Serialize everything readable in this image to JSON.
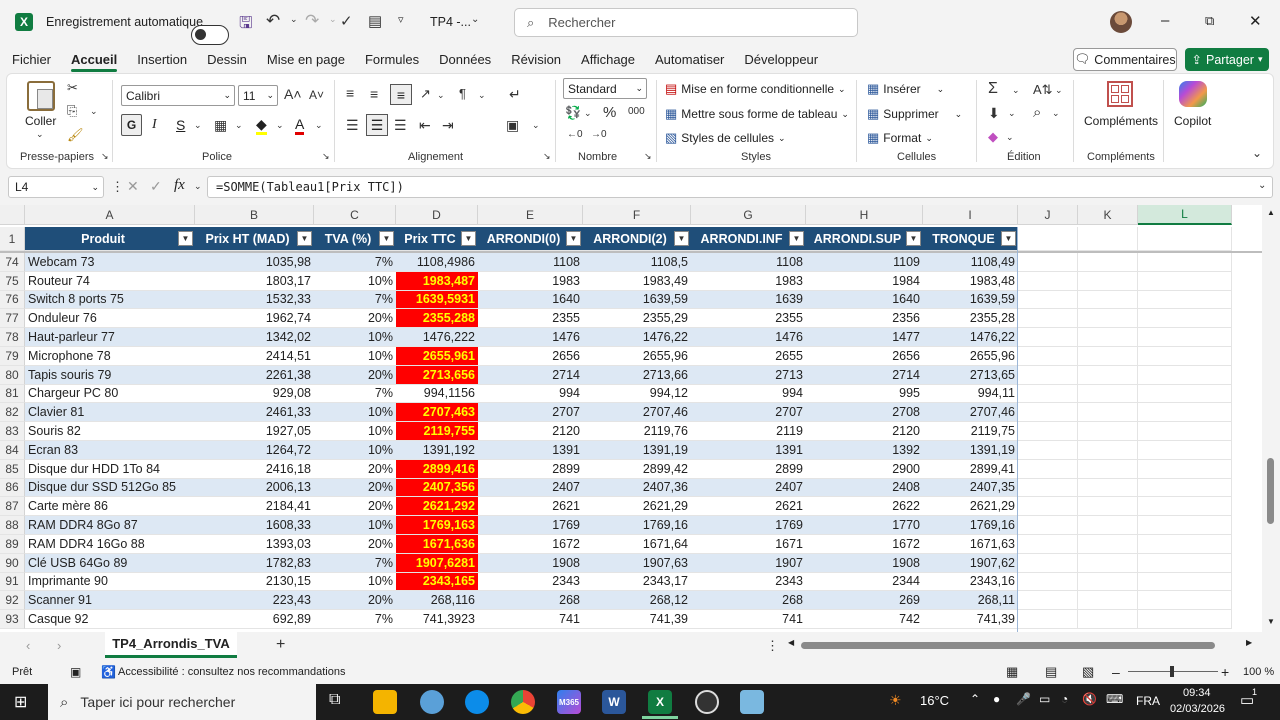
{
  "titlebar": {
    "autosave_label": "Enregistrement automatique",
    "doc_title": "TP4 -...",
    "search_placeholder": "Rechercher"
  },
  "menu": {
    "tabs": [
      "Fichier",
      "Accueil",
      "Insertion",
      "Dessin",
      "Mise en page",
      "Formules",
      "Données",
      "Révision",
      "Affichage",
      "Automatiser",
      "Développeur"
    ],
    "active": "Accueil",
    "comments": "Commentaires",
    "share": "Partager"
  },
  "ribbon": {
    "clipboard": {
      "paste": "Coller",
      "label": "Presse-papiers"
    },
    "font": {
      "name": "Calibri",
      "size": "11",
      "label": "Police"
    },
    "alignment": {
      "label": "Alignement"
    },
    "number": {
      "format": "Standard",
      "label": "Nombre"
    },
    "styles": {
      "cond_format": "Mise en forme conditionnelle",
      "as_table": "Mettre sous forme de tableau",
      "cell_styles": "Styles de cellules",
      "label": "Styles"
    },
    "cells": {
      "insert": "Insérer",
      "delete": "Supprimer",
      "format": "Format",
      "label": "Cellules"
    },
    "editing": {
      "label": "Édition"
    },
    "addins": {
      "btn": "Compléments",
      "label": "Compléments"
    },
    "copilot": "Copilot"
  },
  "formula_bar": {
    "namebox": "L4",
    "formula": "=SOMME(Tableau1[Prix TTC])"
  },
  "grid": {
    "col_letters": [
      "A",
      "B",
      "C",
      "D",
      "E",
      "F",
      "G",
      "H",
      "I",
      "J",
      "K",
      "L"
    ],
    "headers": [
      "Produit",
      "Prix HT (MAD)",
      "TVA (%)",
      "Prix TTC",
      "ARRONDI(0)",
      "ARRONDI(2)",
      "ARRONDI.INF",
      "ARRONDI.SUP",
      "TRONQUE"
    ],
    "header_row_num": "1",
    "rows": [
      {
        "n": "74",
        "p": "Webcam 73",
        "ht": "1035,98",
        "tva": "7%",
        "ttc": "1108,4986",
        "a0": "1108",
        "a2": "1108,5",
        "inf": "1108",
        "sup": "1109",
        "tr": "1108,49",
        "hi": false
      },
      {
        "n": "75",
        "p": "Routeur 74",
        "ht": "1803,17",
        "tva": "10%",
        "ttc": "1983,487",
        "a0": "1983",
        "a2": "1983,49",
        "inf": "1983",
        "sup": "1984",
        "tr": "1983,48",
        "hi": true
      },
      {
        "n": "76",
        "p": "Switch 8 ports 75",
        "ht": "1532,33",
        "tva": "7%",
        "ttc": "1639,5931",
        "a0": "1640",
        "a2": "1639,59",
        "inf": "1639",
        "sup": "1640",
        "tr": "1639,59",
        "hi": true
      },
      {
        "n": "77",
        "p": "Onduleur 76",
        "ht": "1962,74",
        "tva": "20%",
        "ttc": "2355,288",
        "a0": "2355",
        "a2": "2355,29",
        "inf": "2355",
        "sup": "2356",
        "tr": "2355,28",
        "hi": true
      },
      {
        "n": "78",
        "p": "Haut-parleur 77",
        "ht": "1342,02",
        "tva": "10%",
        "ttc": "1476,222",
        "a0": "1476",
        "a2": "1476,22",
        "inf": "1476",
        "sup": "1477",
        "tr": "1476,22",
        "hi": false
      },
      {
        "n": "79",
        "p": "Microphone 78",
        "ht": "2414,51",
        "tva": "10%",
        "ttc": "2655,961",
        "a0": "2656",
        "a2": "2655,96",
        "inf": "2655",
        "sup": "2656",
        "tr": "2655,96",
        "hi": true
      },
      {
        "n": "80",
        "p": "Tapis souris 79",
        "ht": "2261,38",
        "tva": "20%",
        "ttc": "2713,656",
        "a0": "2714",
        "a2": "2713,66",
        "inf": "2713",
        "sup": "2714",
        "tr": "2713,65",
        "hi": true
      },
      {
        "n": "81",
        "p": "Chargeur PC 80",
        "ht": "929,08",
        "tva": "7%",
        "ttc": "994,1156",
        "a0": "994",
        "a2": "994,12",
        "inf": "994",
        "sup": "995",
        "tr": "994,11",
        "hi": false
      },
      {
        "n": "82",
        "p": "Clavier 81",
        "ht": "2461,33",
        "tva": "10%",
        "ttc": "2707,463",
        "a0": "2707",
        "a2": "2707,46",
        "inf": "2707",
        "sup": "2708",
        "tr": "2707,46",
        "hi": true
      },
      {
        "n": "83",
        "p": "Souris 82",
        "ht": "1927,05",
        "tva": "10%",
        "ttc": "2119,755",
        "a0": "2120",
        "a2": "2119,76",
        "inf": "2119",
        "sup": "2120",
        "tr": "2119,75",
        "hi": true
      },
      {
        "n": "84",
        "p": "Ecran 83",
        "ht": "1264,72",
        "tva": "10%",
        "ttc": "1391,192",
        "a0": "1391",
        "a2": "1391,19",
        "inf": "1391",
        "sup": "1392",
        "tr": "1391,19",
        "hi": false
      },
      {
        "n": "85",
        "p": "Disque dur HDD 1To 84",
        "ht": "2416,18",
        "tva": "20%",
        "ttc": "2899,416",
        "a0": "2899",
        "a2": "2899,42",
        "inf": "2899",
        "sup": "2900",
        "tr": "2899,41",
        "hi": true
      },
      {
        "n": "86",
        "p": "Disque dur SSD 512Go 85",
        "ht": "2006,13",
        "tva": "20%",
        "ttc": "2407,356",
        "a0": "2407",
        "a2": "2407,36",
        "inf": "2407",
        "sup": "2408",
        "tr": "2407,35",
        "hi": true
      },
      {
        "n": "87",
        "p": "Carte mère 86",
        "ht": "2184,41",
        "tva": "20%",
        "ttc": "2621,292",
        "a0": "2621",
        "a2": "2621,29",
        "inf": "2621",
        "sup": "2622",
        "tr": "2621,29",
        "hi": true
      },
      {
        "n": "88",
        "p": "RAM DDR4 8Go 87",
        "ht": "1608,33",
        "tva": "10%",
        "ttc": "1769,163",
        "a0": "1769",
        "a2": "1769,16",
        "inf": "1769",
        "sup": "1770",
        "tr": "1769,16",
        "hi": true
      },
      {
        "n": "89",
        "p": "RAM DDR4 16Go 88",
        "ht": "1393,03",
        "tva": "20%",
        "ttc": "1671,636",
        "a0": "1672",
        "a2": "1671,64",
        "inf": "1671",
        "sup": "1672",
        "tr": "1671,63",
        "hi": true
      },
      {
        "n": "90",
        "p": "Clé USB 64Go 89",
        "ht": "1782,83",
        "tva": "7%",
        "ttc": "1907,6281",
        "a0": "1908",
        "a2": "1907,63",
        "inf": "1907",
        "sup": "1908",
        "tr": "1907,62",
        "hi": true
      },
      {
        "n": "91",
        "p": "Imprimante 90",
        "ht": "2130,15",
        "tva": "10%",
        "ttc": "2343,165",
        "a0": "2343",
        "a2": "2343,17",
        "inf": "2343",
        "sup": "2344",
        "tr": "2343,16",
        "hi": true
      },
      {
        "n": "92",
        "p": "Scanner 91",
        "ht": "223,43",
        "tva": "20%",
        "ttc": "268,116",
        "a0": "268",
        "a2": "268,12",
        "inf": "268",
        "sup": "269",
        "tr": "268,11",
        "hi": false
      },
      {
        "n": "93",
        "p": "Casque 92",
        "ht": "692,89",
        "tva": "7%",
        "ttc": "741,3923",
        "a0": "741",
        "a2": "741,39",
        "inf": "741",
        "sup": "742",
        "tr": "741,39",
        "hi": false
      }
    ]
  },
  "sheet": {
    "active_tab": "TP4_Arrondis_TVA"
  },
  "status": {
    "ready": "Prêt",
    "accessibility": "Accessibilité : consultez nos recommandations",
    "zoom": "100 %"
  },
  "taskbar": {
    "search_placeholder": "Taper ici pour rechercher",
    "temperature": "16°C",
    "lang": "FRA",
    "time": "09:34",
    "date": "02/03/2026",
    "notif_count": "1"
  },
  "colors": {
    "excel_green": "#107c41",
    "table_header": "#1f4e79",
    "band": "#dde8f4",
    "highlight": "#ff0000",
    "highlight_text": "#ffff00"
  }
}
